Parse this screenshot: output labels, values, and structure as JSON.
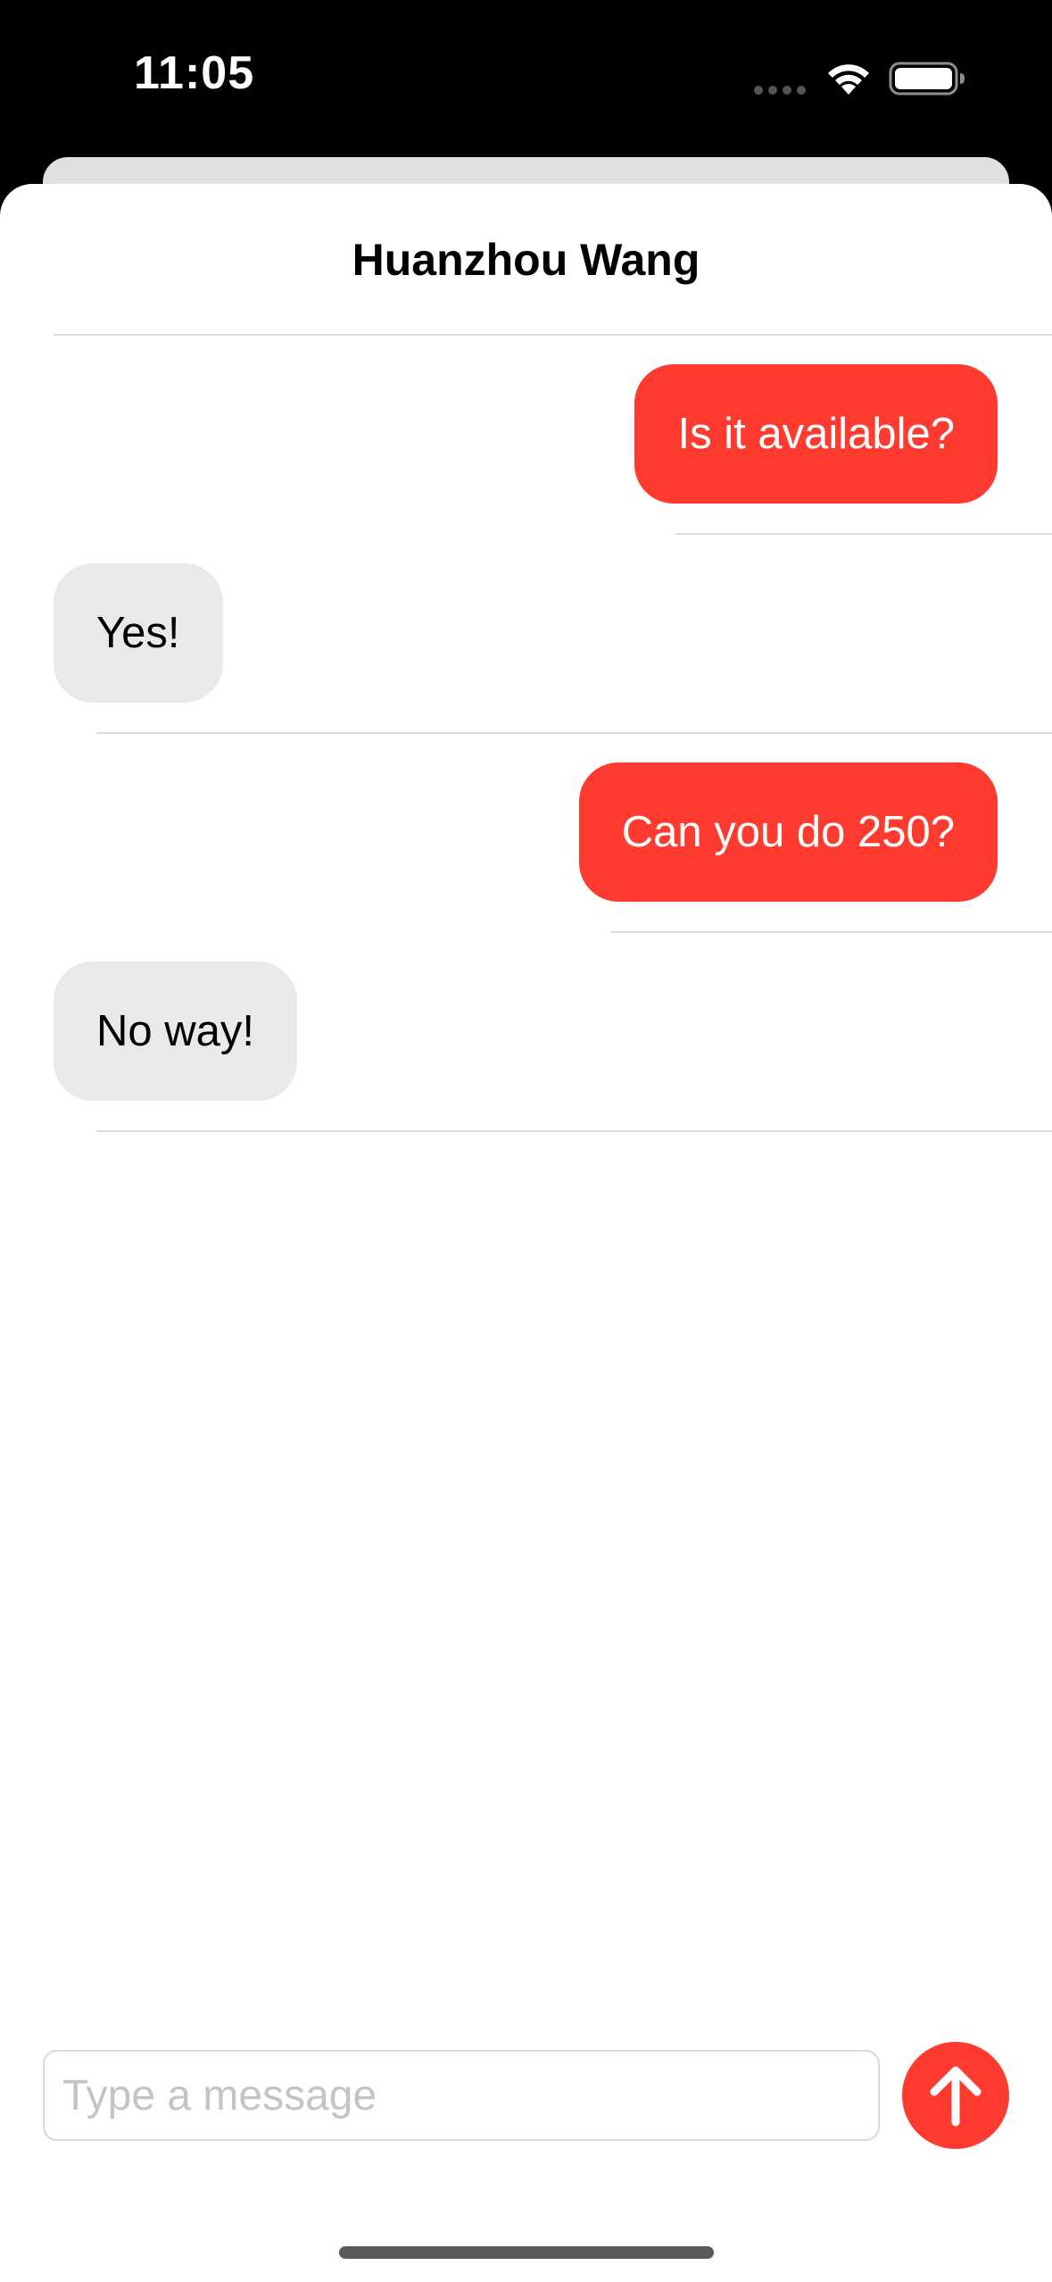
{
  "status_bar": {
    "time": "11:05",
    "wifi_icon": "wifi-icon",
    "battery_icon": "battery-icon",
    "signal_icon": "cellular-signal-icon"
  },
  "header": {
    "title": "Huanzhou Wang"
  },
  "messages": [
    {
      "sender": "me",
      "text": "Is it available?"
    },
    {
      "sender": "other",
      "text": "Yes!"
    },
    {
      "sender": "me",
      "text": "Can you do 250?"
    },
    {
      "sender": "other",
      "text": "No way!"
    }
  ],
  "composer": {
    "placeholder": "Type a message",
    "value": "",
    "send_icon": "arrow-up-icon"
  },
  "colors": {
    "accent": "#ff3b30",
    "received_bubble": "#e9e9eb",
    "background": "#ffffff",
    "status_bar": "#000000"
  }
}
